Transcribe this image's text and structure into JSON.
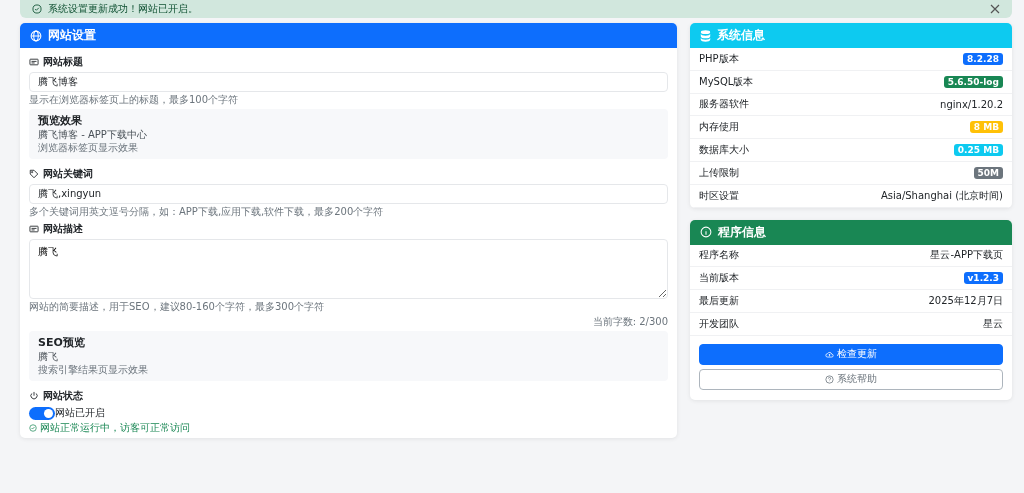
{
  "alert": {
    "text": "系统设置更新成功！网站已开启。"
  },
  "site_settings": {
    "title": "网站设置",
    "site_title": {
      "label": "网站标题",
      "value": "腾飞博客",
      "help": "显示在浏览器标签页上的标题，最多100个字符"
    },
    "title_preview": {
      "heading": "预览效果",
      "text": "腾飞博客 - APP下载中心",
      "note": "浏览器标签页显示效果"
    },
    "keywords": {
      "label": "网站关键词",
      "value": "腾飞,xingyun",
      "help": "多个关键词用英文逗号分隔，如：APP下载,应用下载,软件下载，最多200个字符"
    },
    "description": {
      "label": "网站描述",
      "value": "腾飞",
      "help": "网站的简要描述，用于SEO，建议80-160个字符，最多300个字符",
      "counter": "当前字数: 2/300"
    },
    "seo_preview": {
      "heading": "SEO预览",
      "text": "腾飞",
      "note": "搜索引擎结果页显示效果"
    },
    "status": {
      "label": "网站状态",
      "on": true,
      "switch_label": "网站已开启",
      "message": "网站正常运行中，访客可正常访问"
    }
  },
  "system_info": {
    "title": "系统信息",
    "rows": [
      {
        "label": "PHP版本",
        "value": "8.2.28",
        "kind": "badge",
        "color": "#0d6efd"
      },
      {
        "label": "MySQL版本",
        "value": "5.6.50-log",
        "kind": "badge",
        "color": "#198754"
      },
      {
        "label": "服务器软件",
        "value": "nginx/1.20.2",
        "kind": "text"
      },
      {
        "label": "内存使用",
        "value": "8 MB",
        "kind": "badge",
        "color": "#ffc107"
      },
      {
        "label": "数据库大小",
        "value": "0.25 MB",
        "kind": "badge",
        "color": "#0dcaf0"
      },
      {
        "label": "上传限制",
        "value": "50M",
        "kind": "badge",
        "color": "#6c757d"
      },
      {
        "label": "时区设置",
        "value": "Asia/Shanghai (北京时间)",
        "kind": "text"
      }
    ]
  },
  "program_info": {
    "title": "程序信息",
    "rows": [
      {
        "label": "程序名称",
        "value": "星云-APP下载页",
        "kind": "text"
      },
      {
        "label": "当前版本",
        "value": "v1.2.3",
        "kind": "badge",
        "color": "#0d6efd"
      },
      {
        "label": "最后更新",
        "value": "2025年12月7日",
        "kind": "text"
      },
      {
        "label": "开发团队",
        "value": "星云",
        "kind": "text"
      }
    ],
    "buttons": [
      {
        "label": "检查更新",
        "kind": "primary"
      },
      {
        "label": "系统帮助",
        "kind": "outline"
      }
    ]
  }
}
